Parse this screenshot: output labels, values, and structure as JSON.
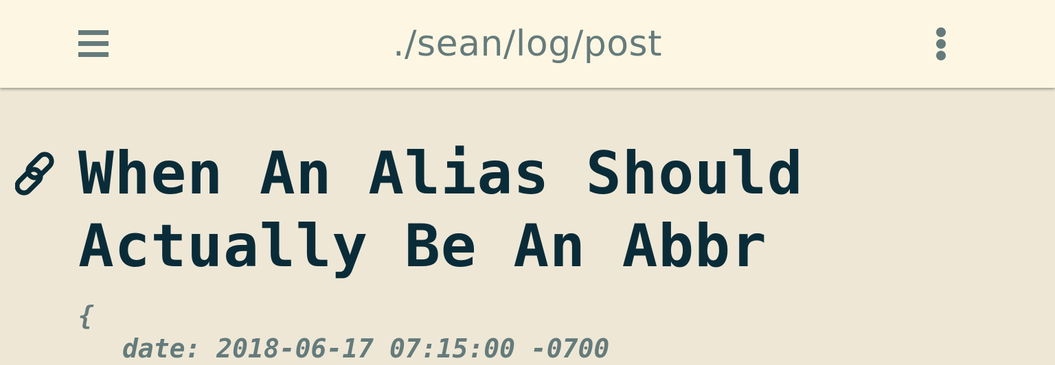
{
  "header": {
    "title": "./sean/log/post",
    "menu_icon": "hamburger-menu-icon",
    "more_icon": "more-vertical-icon"
  },
  "post": {
    "permalink_icon": "link-icon",
    "title": "When An Alias Should Actually Be An Abbr",
    "meta_open": "{",
    "meta_date_key": "date:",
    "meta_date_value": "2018-06-17 07:15:00 -0700"
  },
  "colors": {
    "header_bg": "#fdf6e3",
    "page_bg": "#eee7d6",
    "title_text": "#0a2c38",
    "muted_text": "#657b7b"
  }
}
